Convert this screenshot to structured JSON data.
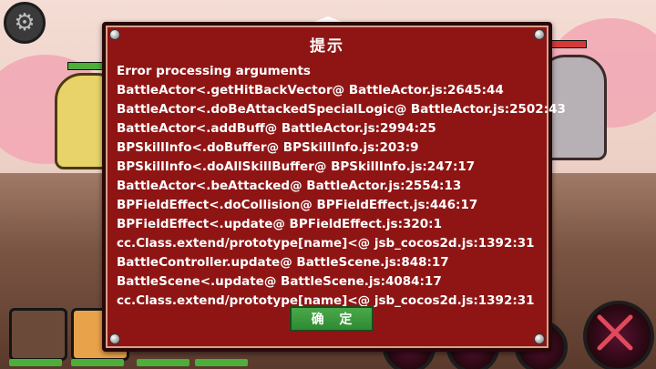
{
  "dialog": {
    "title": "提示",
    "lines": [
      "Error processing arguments",
      "BattleActor<.getHitBackVector@ BattleActor.js:2645:44",
      "BattleActor<.doBeAttackedSpecialLogic@ BattleActor.js:2502:43",
      "BattleActor<.addBuff@ BattleActor.js:2994:25",
      "BPSkillInfo<.doBuffer@ BPSkillInfo.js:203:9",
      "BPSkillInfo<.doAllSkillBuffer@ BPSkillInfo.js:247:17",
      "BattleActor<.beAttacked@ BattleActor.js:2554:13",
      "BPFieldEffect<.doCollision@ BPFieldEffect.js:446:17",
      "BPFieldEffect<.update@ BPFieldEffect.js:320:1",
      "cc.Class.extend/prototype[name]<@ jsb_cocos2d.js:1392:31",
      "BattleController.update@ BattleScene.js:848:17",
      "BattleScene<.update@ BattleScene.js:4084:17",
      "cc.Class.extend/prototype[name]<@ jsb_cocos2d.js:1392:31"
    ],
    "confirm_label": "确 定"
  },
  "colors": {
    "dialog_bg": "#8f1515",
    "button_green": "#3a9a3c",
    "hp_green": "#4caf3a",
    "hp_red": "#d23a3a"
  },
  "icons": {
    "settings": "gear-icon",
    "skill": "crossed-swords-icon"
  }
}
